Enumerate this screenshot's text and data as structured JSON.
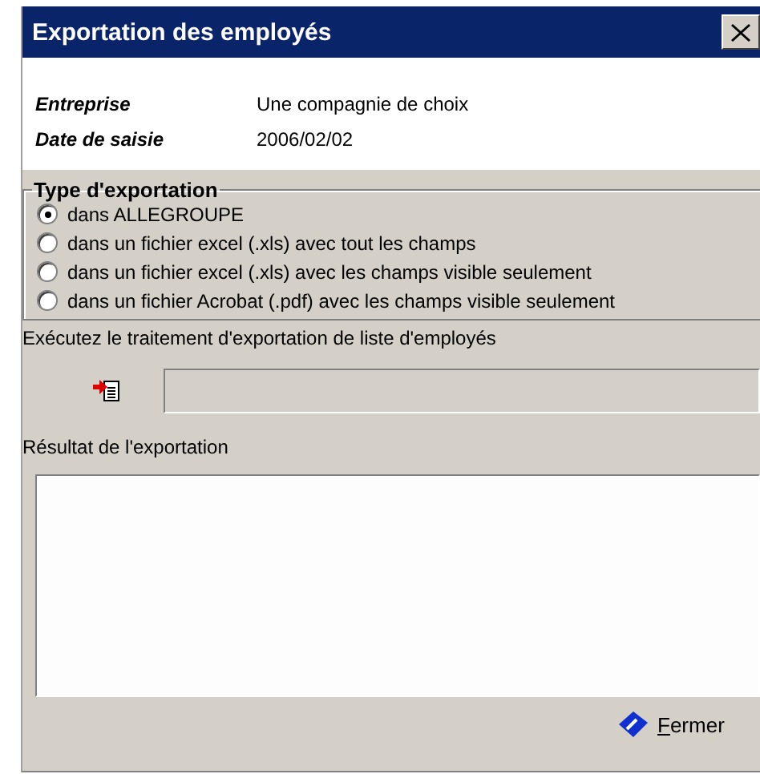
{
  "window": {
    "title": "Exportation des employés"
  },
  "info": [
    {
      "label": "Entreprise",
      "value": "Une compagnie de choix"
    },
    {
      "label": "Date de saisie",
      "value": "2006/02/02"
    }
  ],
  "export_type": {
    "title": "Type d'exportation",
    "options": [
      {
        "label": "dans ALLEGROUPE",
        "selected": true
      },
      {
        "label": "dans un fichier excel (.xls) avec tout les champs",
        "selected": false
      },
      {
        "label": "dans un fichier excel (.xls) avec les champs visible seulement",
        "selected": false
      },
      {
        "label": "dans un fichier Acrobat (.pdf) avec les champs visible seulement",
        "selected": false
      }
    ]
  },
  "run_label": "Exécutez le traitement d'exportation de liste d'employés",
  "result_label": "Résultat de l'exportation",
  "buttons": [
    {
      "label": "Fermer"
    }
  ]
}
